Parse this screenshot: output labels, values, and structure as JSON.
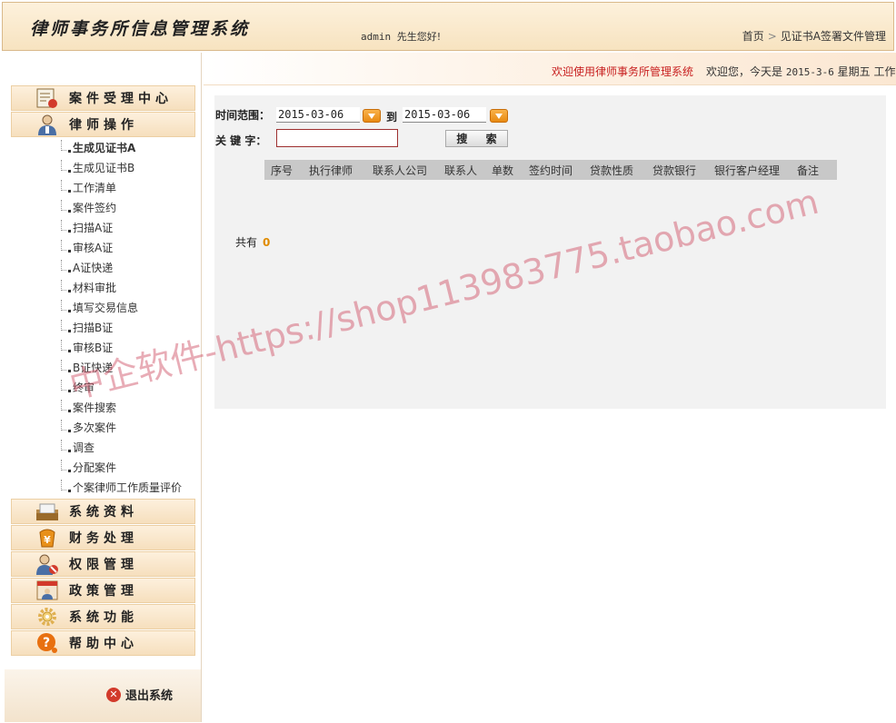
{
  "header": {
    "app_title": "律师事务所信息管理系统",
    "user": "admin",
    "greeting": "先生您好!",
    "breadcrumb": {
      "home": "首页",
      "current": "见证书A签署文件管理"
    }
  },
  "welcome": {
    "message": "欢迎使用律师事务所管理系统",
    "today_prefix": "欢迎您，今天是",
    "date": "2015-3-6",
    "weekday": "星期五",
    "status": "工作"
  },
  "sidebar": {
    "categories": [
      {
        "label": "案件受理中心",
        "icon": "certificate-icon"
      },
      {
        "label": "律师操作",
        "icon": "lawyer-icon"
      }
    ],
    "lawyer_items": [
      "生成见证书A",
      "生成见证书B",
      "工作清单",
      "案件签约",
      "扫描A证",
      "审核A证",
      "A证快递",
      "材料审批",
      "填写交易信息",
      "扫描B证",
      "审核B证",
      "B证快递",
      "终审",
      "案件搜索",
      "多次案件",
      "调查",
      "分配案件",
      "个案律师工作质量评价"
    ],
    "active_item": "生成见证书A",
    "bottom_categories": [
      {
        "label": "系统资料",
        "icon": "folder-icon"
      },
      {
        "label": "财务处理",
        "icon": "money-icon"
      },
      {
        "label": "权限管理",
        "icon": "permission-icon"
      },
      {
        "label": "政策管理",
        "icon": "policy-icon"
      },
      {
        "label": "系统功能",
        "icon": "gear-icon"
      },
      {
        "label": "帮助中心",
        "icon": "help-icon"
      }
    ],
    "logout_label": "退出系统"
  },
  "search": {
    "time_range_label": "时间范围：",
    "date_from": "2015-03-06",
    "to_label": "到",
    "date_to": "2015-03-06",
    "keyword_label": "关 键 字：",
    "keyword_value": "",
    "search_button": "搜 索"
  },
  "table": {
    "columns": [
      "序号",
      "执行律师",
      "联系人公司",
      "联系人",
      "单数",
      "签约时间",
      "贷款性质",
      "贷款银行",
      "银行客户经理",
      "备注"
    ],
    "rows": []
  },
  "total": {
    "label": "共有",
    "value": "0"
  },
  "watermark": "中企软件-https://shop113983775.taobao.com"
}
